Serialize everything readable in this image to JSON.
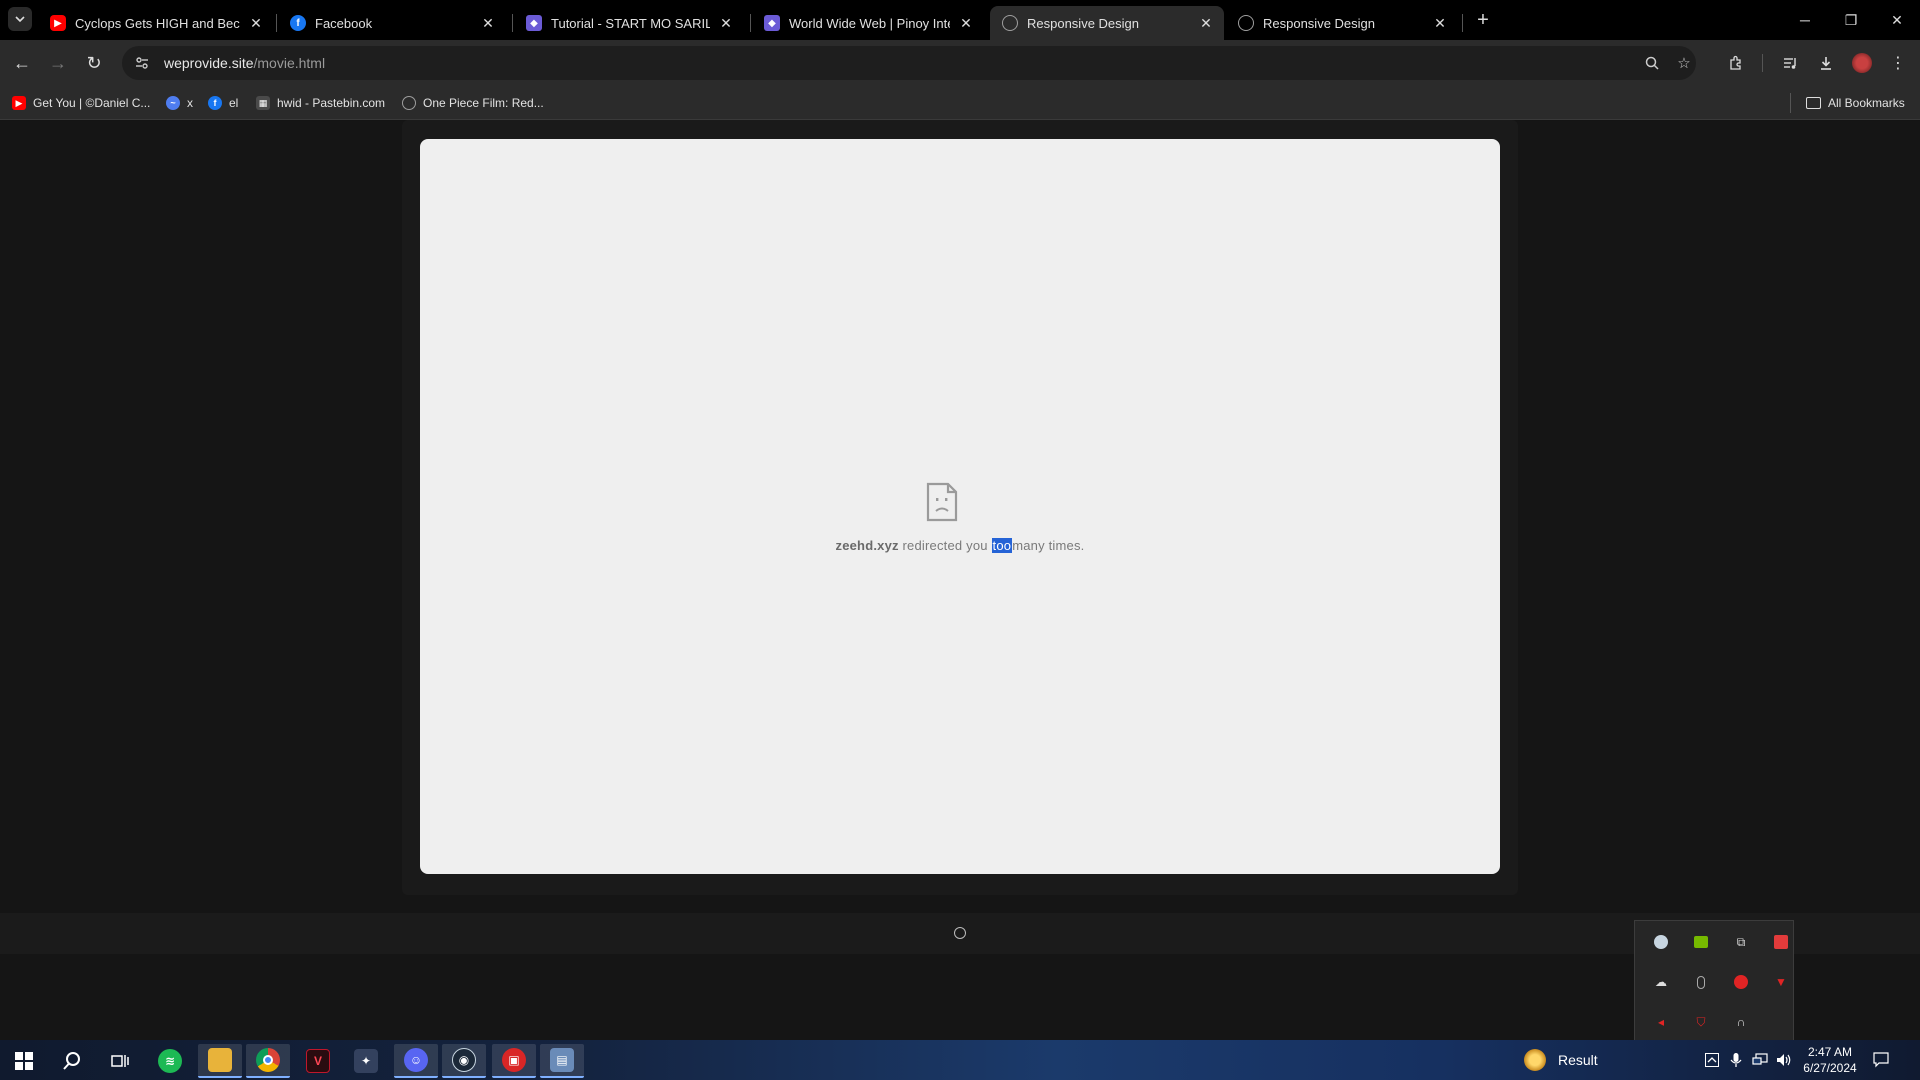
{
  "browser": {
    "tabs": [
      {
        "title": "Cyclops Gets HIGH and Becom",
        "favicon": "youtube-icon",
        "color": "#ff0000",
        "active": false
      },
      {
        "title": "Facebook",
        "favicon": "facebook-icon",
        "color": "#1877f2",
        "active": false
      },
      {
        "title": "Tutorial - START MO SARILI MO",
        "favicon": "shield-icon",
        "color": "#6b5bd6",
        "active": false
      },
      {
        "title": "World Wide Web | Pinoy Interne",
        "favicon": "shield-icon",
        "color": "#6b5bd6",
        "active": false
      },
      {
        "title": "Responsive Design",
        "favicon": "globe-icon",
        "color": "#9e9e9e",
        "active": true
      },
      {
        "title": "Responsive Design",
        "favicon": "globe-icon",
        "color": "#9e9e9e",
        "active": false
      }
    ],
    "address": {
      "host": "weprovide.site",
      "path": "/movie.html"
    },
    "bookmarks": [
      {
        "label": "Get You | ©Daniel C...",
        "icon": "youtube-icon",
        "color": "#ff0000"
      },
      {
        "label": "x",
        "icon": "messenger-icon",
        "color": "#4f7df0"
      },
      {
        "label": "el",
        "icon": "facebook-icon",
        "color": "#1877f2"
      },
      {
        "label": "hwid - Pastebin.com",
        "icon": "pastebin-icon",
        "color": "#666666"
      },
      {
        "label": "One Piece Film: Red...",
        "icon": "globe-icon",
        "color": "#9e9e9e"
      }
    ],
    "all_bookmarks_label": "All Bookmarks"
  },
  "page": {
    "error_host": "zeehd.xyz",
    "error_mid": " redirected you ",
    "error_highlight": "too",
    "error_tail": "many times."
  },
  "taskbar": {
    "apps": [
      {
        "name": "spotify",
        "color": "#1db954",
        "running": false
      },
      {
        "name": "file-explorer",
        "color": "#e8b33a",
        "running": true
      },
      {
        "name": "chrome",
        "color": "#db4437",
        "running": true
      },
      {
        "name": "valorant",
        "color": "#c0172b",
        "running": false
      },
      {
        "name": "game-launcher",
        "color": "#8ab4f8",
        "running": false
      },
      {
        "name": "discord",
        "color": "#5865f2",
        "running": true
      },
      {
        "name": "steam",
        "color": "#1b2838",
        "running": true
      },
      {
        "name": "red-app",
        "color": "#d92626",
        "running": true
      },
      {
        "name": "control-panel",
        "color": "#6a8bb8",
        "running": true
      }
    ],
    "weather_label": "Result",
    "time": "2:47 AM",
    "date": "6/27/2024"
  }
}
